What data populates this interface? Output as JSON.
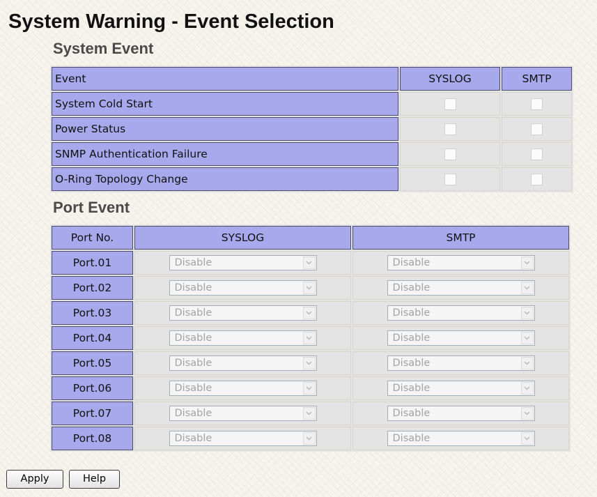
{
  "page": {
    "title": "System Warning - Event Selection"
  },
  "system_event": {
    "title": "System Event",
    "headers": {
      "event": "Event",
      "syslog": "SYSLOG",
      "smtp": "SMTP"
    },
    "rows": [
      {
        "event": "System Cold Start",
        "syslog": false,
        "smtp": false
      },
      {
        "event": "Power Status",
        "syslog": false,
        "smtp": false
      },
      {
        "event": "SNMP Authentication Failure",
        "syslog": false,
        "smtp": false
      },
      {
        "event": "O-Ring Topology Change",
        "syslog": false,
        "smtp": false
      }
    ]
  },
  "port_event": {
    "title": "Port Event",
    "headers": {
      "port": "Port No.",
      "syslog": "SYSLOG",
      "smtp": "SMTP"
    },
    "rows": [
      {
        "port": "Port.01",
        "syslog": "Disable",
        "smtp": "Disable"
      },
      {
        "port": "Port.02",
        "syslog": "Disable",
        "smtp": "Disable"
      },
      {
        "port": "Port.03",
        "syslog": "Disable",
        "smtp": "Disable"
      },
      {
        "port": "Port.04",
        "syslog": "Disable",
        "smtp": "Disable"
      },
      {
        "port": "Port.05",
        "syslog": "Disable",
        "smtp": "Disable"
      },
      {
        "port": "Port.06",
        "syslog": "Disable",
        "smtp": "Disable"
      },
      {
        "port": "Port.07",
        "syslog": "Disable",
        "smtp": "Disable"
      },
      {
        "port": "Port.08",
        "syslog": "Disable",
        "smtp": "Disable"
      }
    ]
  },
  "buttons": {
    "apply": "Apply",
    "help": "Help"
  },
  "colors": {
    "header_bg": "#a8a8ec",
    "page_bg": "#f6f4ec",
    "disabled_text": "#a3a3a3"
  },
  "icons": {
    "dropdown": "chevron-down-icon"
  }
}
